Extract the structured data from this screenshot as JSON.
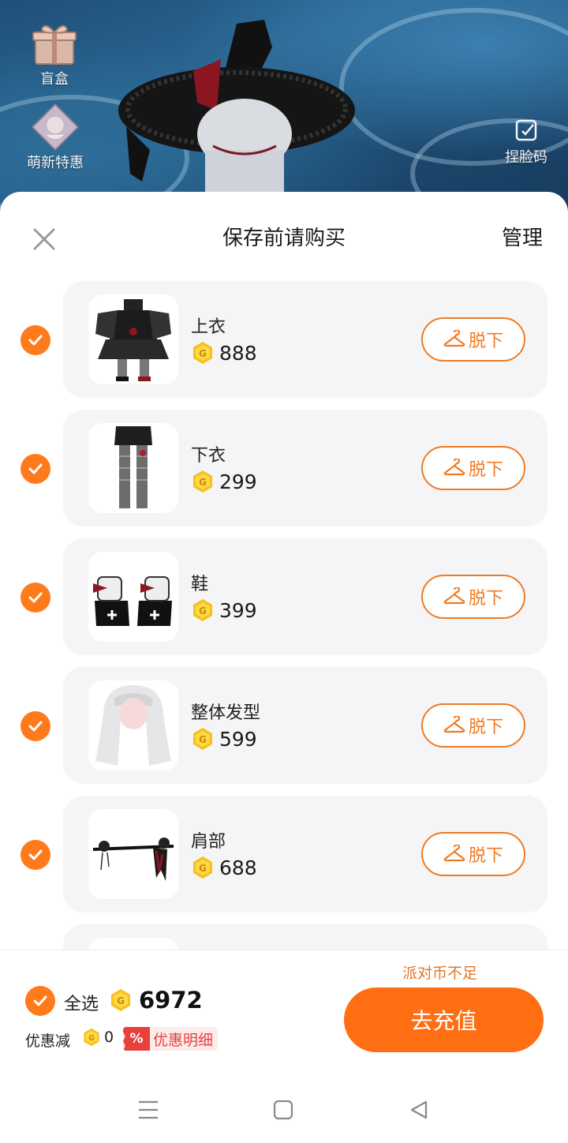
{
  "background": {
    "side_entries": [
      {
        "label": "盲盒",
        "icon": "gift-box-icon"
      },
      {
        "label": "萌新特惠",
        "icon": "newbie-offer-icon"
      }
    ],
    "right_entry": {
      "label": "捏脸码",
      "icon": "face-code-icon"
    }
  },
  "sheet": {
    "title": "保存前请购买",
    "manage_label": "管理",
    "close_icon": "close-icon"
  },
  "items": [
    {
      "name": "上衣",
      "price": "888",
      "action": "脱下",
      "checked": true
    },
    {
      "name": "下衣",
      "price": "299",
      "action": "脱下",
      "checked": true
    },
    {
      "name": "鞋",
      "price": "399",
      "action": "脱下",
      "checked": true
    },
    {
      "name": "整体发型",
      "price": "599",
      "action": "脱下",
      "checked": true
    },
    {
      "name": "肩部",
      "price": "688",
      "action": "脱下",
      "checked": true
    }
  ],
  "footer": {
    "insufficient_text": "派对币不足",
    "select_all_label": "全选",
    "total": "6972",
    "discount_label": "优惠减",
    "discount_value": "0",
    "discount_badge": "%",
    "detail_label": "优惠明细",
    "recharge_label": "去充值"
  },
  "colors": {
    "accent": "#ff6e12",
    "coin": "#f4c21a",
    "discount_red": "#e8403a"
  },
  "system_nav": [
    "menu-icon",
    "home-icon",
    "back-icon"
  ]
}
